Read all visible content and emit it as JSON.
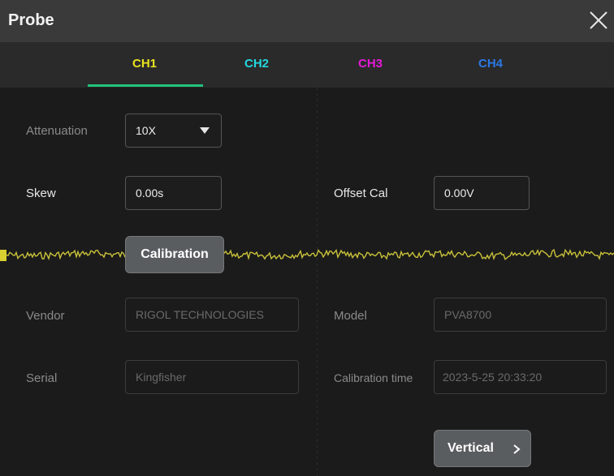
{
  "window": {
    "title": "Probe",
    "close_icon": "close-icon"
  },
  "tabs": [
    {
      "label": "CH1",
      "color": "#e9e321",
      "active": true
    },
    {
      "label": "CH2",
      "color": "#23d7e0",
      "active": false
    },
    {
      "label": "CH3",
      "color": "#e21ad6",
      "active": false
    },
    {
      "label": "CH4",
      "color": "#2b78e4",
      "active": false
    }
  ],
  "active_tab_underline_color": "#22c27a",
  "trace_color": "#c8c13a",
  "form": {
    "attenuation": {
      "label": "Attenuation",
      "value": "10X"
    },
    "skew": {
      "label": "Skew",
      "value": "0.00s"
    },
    "offset_cal": {
      "label": "Offset Cal",
      "value": "0.00V"
    },
    "calibration_button": "Calibration",
    "vendor": {
      "label": "Vendor",
      "value": "RIGOL TECHNOLOGIES"
    },
    "model": {
      "label": "Model",
      "value": "PVA8700"
    },
    "serial": {
      "label": "Serial",
      "value": "Kingfisher"
    },
    "calibration_time": {
      "label": "Calibration time",
      "value": "2023-5-25 20:33:20"
    },
    "vertical_button": "Vertical",
    "vertical_icon": "chevron-right-icon"
  }
}
